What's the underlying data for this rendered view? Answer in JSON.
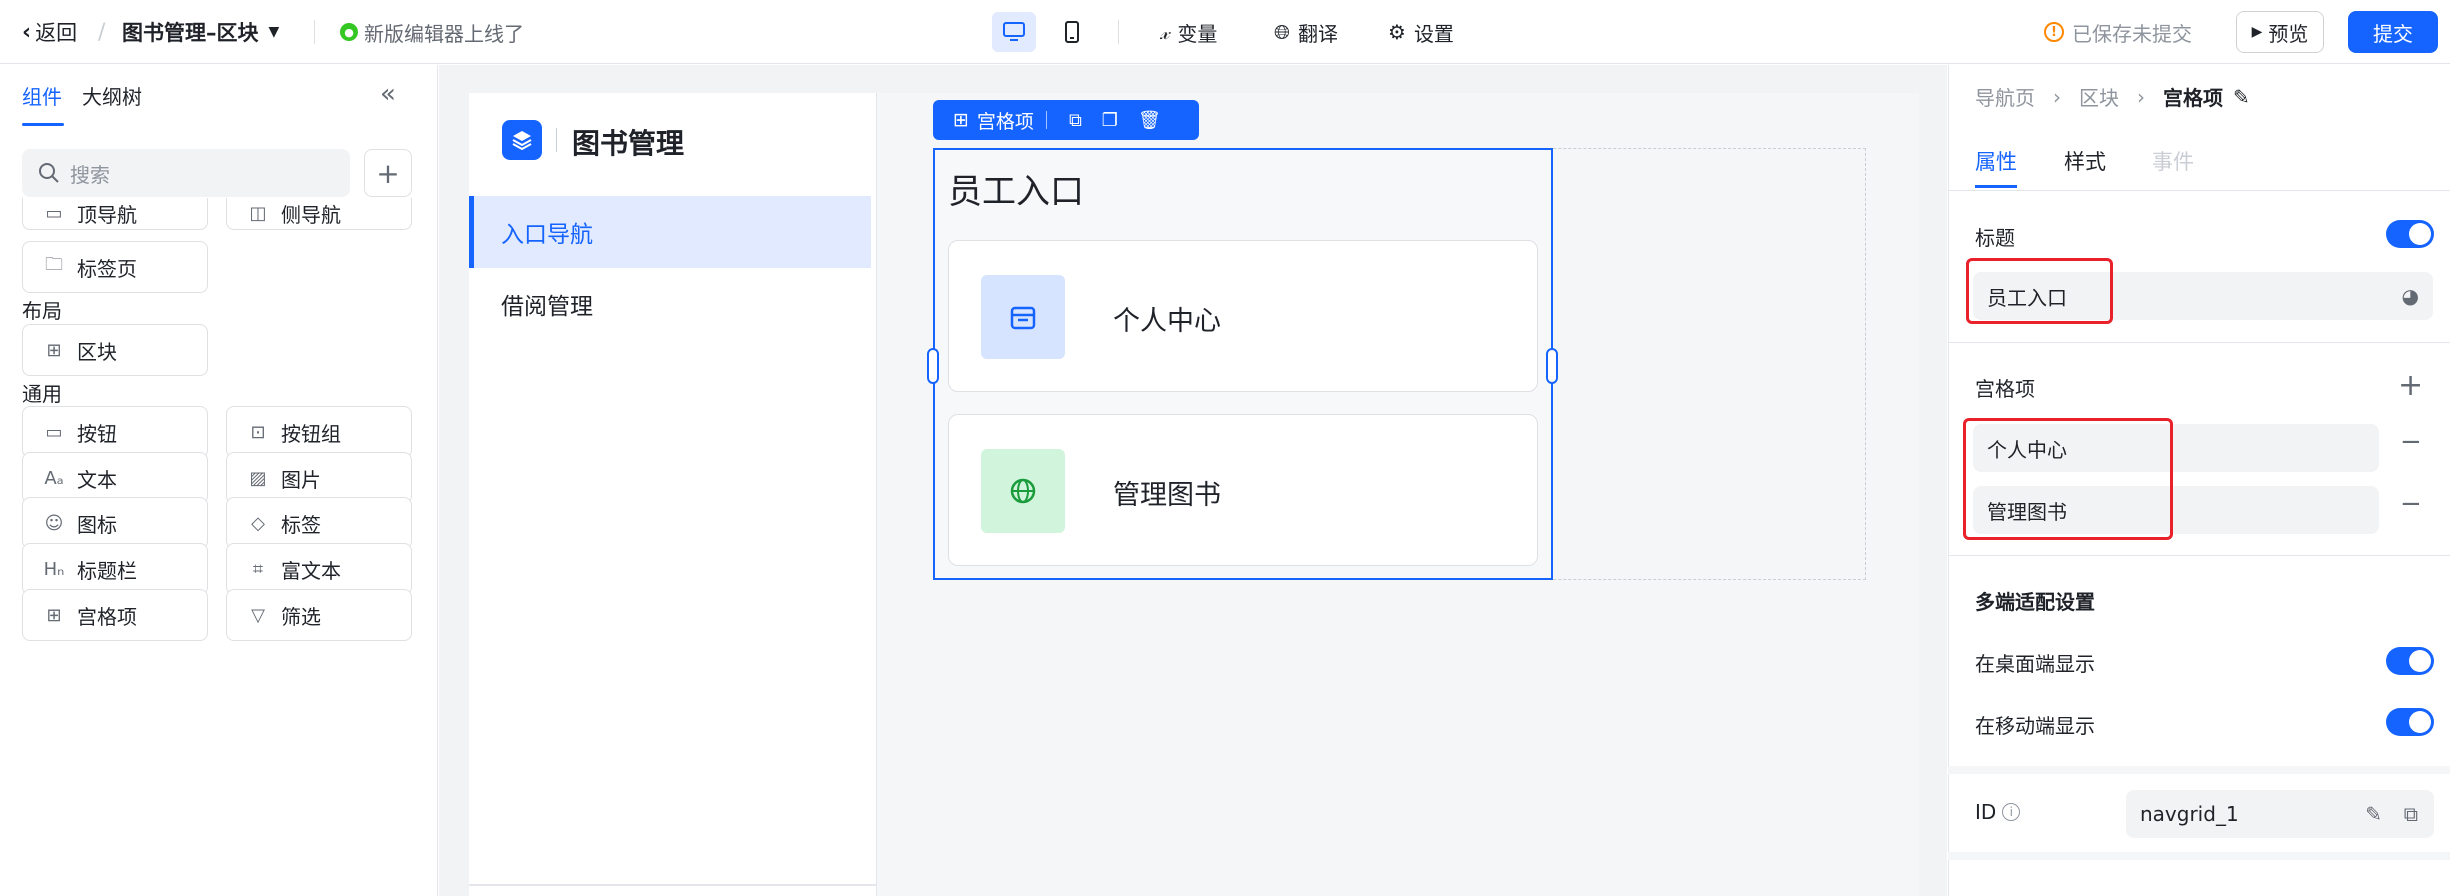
{
  "topbar": {
    "back_label": "返回",
    "separator": "/",
    "page_title": "图书管理–区块",
    "notice": "新版编辑器上线了",
    "variables": "变量",
    "translate": "翻译",
    "settings": "设置",
    "saved_status": "已保存未提交",
    "preview": "预览",
    "submit": "提交"
  },
  "left_panel": {
    "tabs": [
      "组件",
      "大纲树"
    ],
    "search_placeholder": "搜索",
    "top_items": [
      {
        "label": "顶导航",
        "icon": "top-nav-icon"
      },
      {
        "label": "侧导航",
        "icon": "side-nav-icon"
      },
      {
        "label": "标签页",
        "icon": "tab-page-icon"
      }
    ],
    "layout_section": "布局",
    "layout_items": [
      {
        "label": "区块",
        "icon": "block-icon"
      }
    ],
    "general_section": "通用",
    "general_items": [
      {
        "label": "按钮",
        "icon": "button-icon"
      },
      {
        "label": "按钮组",
        "icon": "button-group-icon"
      },
      {
        "label": "文本",
        "icon": "text-icon"
      },
      {
        "label": "图片",
        "icon": "image-icon"
      },
      {
        "label": "图标",
        "icon": "smile-icon"
      },
      {
        "label": "标签",
        "icon": "tag-icon"
      },
      {
        "label": "标题栏",
        "icon": "heading-icon"
      },
      {
        "label": "富文本",
        "icon": "rich-text-icon"
      },
      {
        "label": "宫格项",
        "icon": "grid-icon"
      },
      {
        "label": "筛选",
        "icon": "filter-icon"
      }
    ]
  },
  "app": {
    "title": "图书管理",
    "nav": [
      "入口导航",
      "借阅管理"
    ],
    "toolbar_label": "宫格项",
    "block_title": "员工入口",
    "cards": [
      {
        "label": "个人中心",
        "icon": "calendar-icon",
        "color": "#d6e4ff"
      },
      {
        "label": "管理图书",
        "icon": "globe-icon",
        "color": "#d1f5dc"
      }
    ]
  },
  "right_panel": {
    "breadcrumb": [
      "导航页",
      "区块",
      "宫格项"
    ],
    "tabs": [
      "属性",
      "样式",
      "事件"
    ],
    "title_label": "标题",
    "title_value": "员工入口",
    "grid_label": "宫格项",
    "grid_items": [
      "个人中心",
      "管理图书"
    ],
    "multi_label": "多端适配设置",
    "desktop_label": "在桌面端显示",
    "mobile_label": "在移动端显示",
    "id_label": "ID",
    "id_value": "navgrid_1"
  },
  "colors": {
    "accent": "#1664ff",
    "highlight": "#e8212b"
  }
}
